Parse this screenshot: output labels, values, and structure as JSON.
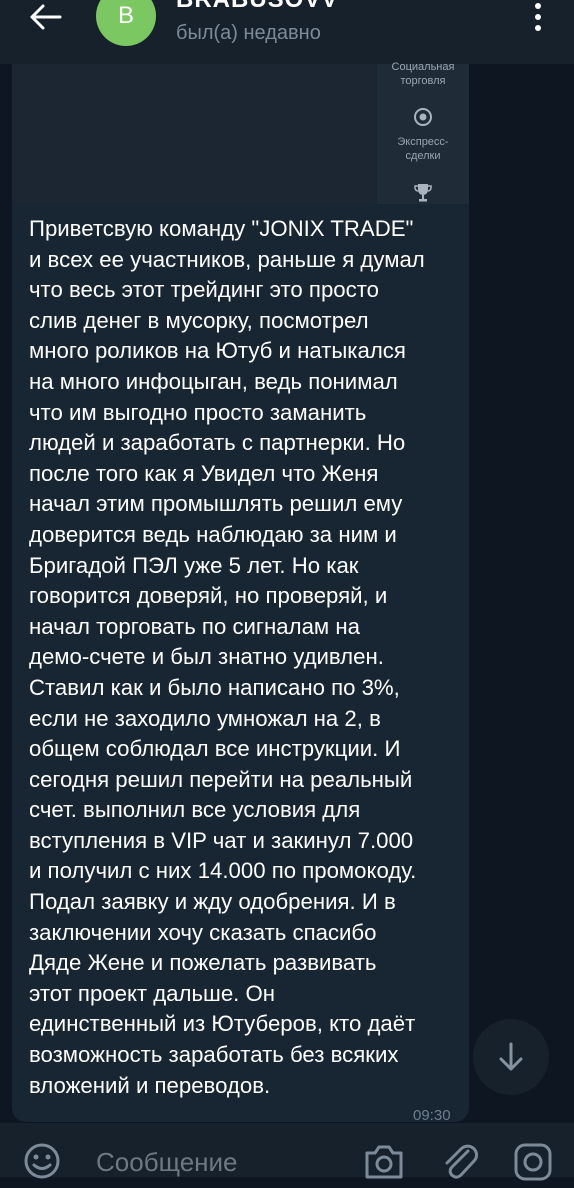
{
  "header": {
    "avatar_letter": "B",
    "chat_name": "BRABUSOVV",
    "status": "был(а) недавно"
  },
  "photo": {
    "sidebar_items": [
      {
        "label": "Социальная торговля",
        "icon": "social-trading-icon"
      },
      {
        "label": "Экспресс-сделки",
        "icon": "target-icon"
      },
      {
        "label": "",
        "icon": "trophy-icon"
      }
    ]
  },
  "message": {
    "text": "Приветсвую команду \"JONIX TRADE\"\nи всех ее участников, раньше я думал\nчто весь этот трейдинг это просто\nслив денег в мусорку, посмотрел\nмного роликов на Ютуб и натыкался\nна много инфоцыган, ведь понимал\nчто им выгодно просто заманить\nлюдей и заработать с партнерки. Но\nпосле того как я Увидел что Женя\nначал этим промышлять решил ему\nдоверится ведь наблюдаю за ним и\nБригадой ПЭЛ уже 5 лет. Но как\nговорится доверяй, но проверяй, и\nначал торговать по сигналам на\nдемо-счете и был знатно удивлен.\nСтавил как и было написано по 3%,\nесли не заходило умножал на 2, в\nобщем соблюдал все инструкции. И\nсегодня решил перейти на реальный\nсчет. выполнил все условия для\nвступления в VIP чат и закинул 7.000\nи получил с них 14.000 по промокоду.\nПодал заявку и жду одобрения. И в\nзаключении хочу сказать спасибо\nДяде Жене и пожелать развивать\nэтот проект дальше. Он\nединственный из Ютуберов, кто даёт\nвозможность заработать без всяких\nвложений и переводов.",
    "time": "09:30"
  },
  "input": {
    "placeholder": "Сообщение"
  },
  "icons": {
    "back": "arrow-left-icon",
    "menu": "more-vertical-icon",
    "scroll": "arrow-down-icon",
    "emoji": "smile-icon",
    "camera": "camera-icon",
    "attach": "paperclip-icon",
    "instagram": "camera-round-icon"
  },
  "colors": {
    "background": "#0e1621",
    "header": "#17212b",
    "bubble": "#182533",
    "avatar": "#7bc862",
    "muted_text": "#7d8b99"
  }
}
